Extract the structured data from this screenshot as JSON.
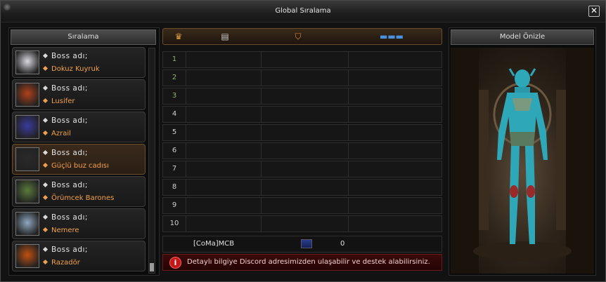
{
  "window": {
    "title": "Global Sıralama",
    "close_label": "✕"
  },
  "left_panel": {
    "header": "Sıralama",
    "bosses": [
      {
        "label": "Boss adı;",
        "name": "Dokuz Kuyruk",
        "thumb_color": "#d8d8e0"
      },
      {
        "label": "Boss adı;",
        "name": "Lusifer",
        "thumb_color": "#b0401a"
      },
      {
        "label": "Boss adı;",
        "name": "Azrail",
        "thumb_color": "#3a3aa0"
      },
      {
        "label": "Boss adı;",
        "name": "Güçlü buz cadısı",
        "thumb_color": "#2a2a2a"
      },
      {
        "label": "Boss adı;",
        "name": "Örümcek Barones",
        "thumb_color": "#5a7a3a"
      },
      {
        "label": "Boss adı;",
        "name": "Nemere",
        "thumb_color": "#90a8c0"
      },
      {
        "label": "Boss adı;",
        "name": "Razadör",
        "thumb_color": "#c05010"
      }
    ]
  },
  "tabs": [
    {
      "name": "crown-icon",
      "glyph": "♛",
      "color": "#e0a040"
    },
    {
      "name": "id-card-icon",
      "glyph": "▤",
      "color": "#c8c8c8"
    },
    {
      "name": "guild-emblem-icon",
      "glyph": "⛉",
      "color": "#d89040"
    },
    {
      "name": "bar-icon",
      "glyph": "▬▬▬",
      "color": "#4a90e0"
    }
  ],
  "ranking": {
    "rows": [
      "1",
      "2",
      "3",
      "4",
      "5",
      "6",
      "7",
      "8",
      "9",
      "10"
    ],
    "self": {
      "name": "[CoMa]MCB",
      "score": "0"
    }
  },
  "info": {
    "text": "Detaylı bilgiye Discord adresimizden ulaşabilir ve destek alabilirsiniz."
  },
  "right_panel": {
    "header": "Model Önizle"
  }
}
